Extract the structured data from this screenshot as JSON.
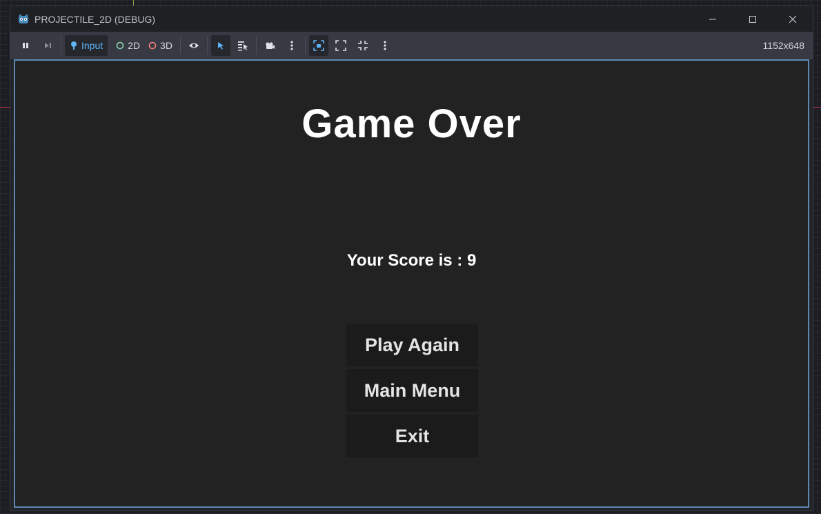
{
  "window": {
    "title": "PROJECTILE_2D (DEBUG)",
    "controls": [
      "minimize-icon",
      "maximize-icon",
      "close-icon"
    ]
  },
  "toolbar": {
    "pause_icon": "pause-icon",
    "step_icon": "next-frame-icon",
    "input_label": "Input",
    "label_2d": "2D",
    "label_3d": "3D",
    "color_2d": "#8fd3a4",
    "color_3d": "#fc7f7f",
    "accent": "#5fb4f6",
    "resolution": "1152x648"
  },
  "game": {
    "title": "Game Over",
    "score_text": "Your Score is : 9",
    "buttons": {
      "play_again": "Play Again",
      "main_menu": "Main Menu",
      "exit": "Exit"
    }
  }
}
